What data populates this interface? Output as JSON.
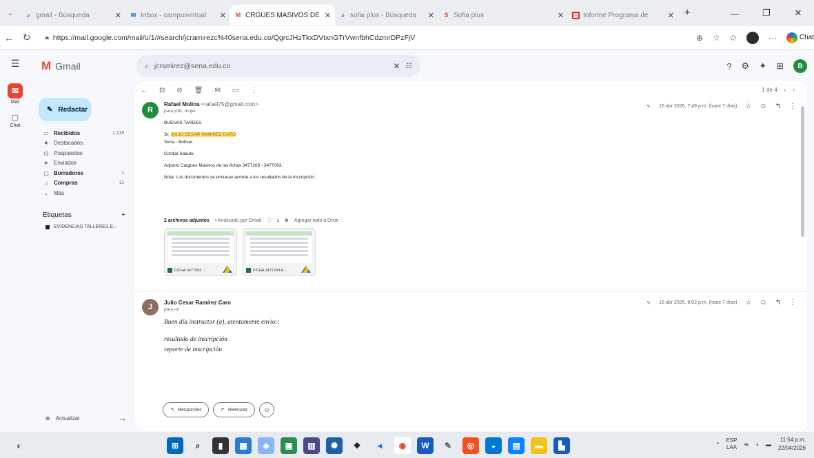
{
  "browser": {
    "tabs": [
      {
        "title": "gmail - Búsqueda",
        "fav": "search",
        "active": false
      },
      {
        "title": "Inbox - campusvirtual",
        "fav": "mail",
        "active": false
      },
      {
        "title": "CRGUES MASIVOS DE",
        "fav": "gmail",
        "active": true
      },
      {
        "title": "sofia plus - Búsqueda",
        "fav": "search",
        "active": false
      },
      {
        "title": "Sofia plus",
        "fav": "sofia",
        "active": false
      },
      {
        "title": "Informe Programa de",
        "fav": "pdf",
        "active": false
      }
    ],
    "url": "https://mail.google.com/mail/u/1/#search/jcramirezc%40sena.edu.co/QgrcJHzTkxDVtxnGTrVwnfbhCdzmrDPzFjV",
    "copilot_label": "Chat"
  },
  "gmail": {
    "app_name": "Gmail",
    "rail_mail_label": "Mail",
    "rail_chat_label": "Chat",
    "search_query": "jcramirez@sena.edu.co",
    "account_initial": "B",
    "compose_label": "Redactar",
    "nav": [
      {
        "icon": "inbox",
        "label": "Recibidos",
        "count": "1.119",
        "bold": true
      },
      {
        "icon": "star",
        "label": "Destacados",
        "count": "",
        "bold": false
      },
      {
        "icon": "clock",
        "label": "Pospuestos",
        "count": "",
        "bold": false
      },
      {
        "icon": "send",
        "label": "Enviados",
        "count": "",
        "bold": false
      },
      {
        "icon": "draft",
        "label": "Borradores",
        "count": "1",
        "bold": true
      },
      {
        "icon": "cart",
        "label": "Compras",
        "count": "11",
        "bold": true
      },
      {
        "icon": "chevron",
        "label": "Más",
        "count": "",
        "bold": false
      }
    ],
    "labels_title": "Etiquetas",
    "labels_add": "+",
    "label_item": "EVIDENCIAS TALLERES E...",
    "upgrade_label": "Actualizar",
    "pager_text": "1 de 4"
  },
  "thread": {
    "msg1": {
      "avatar": "R",
      "avatar_color": "#1e8e3e",
      "sender": "Rafael Molina",
      "email": "<rafael75@gmail.com>",
      "to": "para jcdc, mujer",
      "meta": "15 abr 2026, 7:49 p.m. (hace 7 días)",
      "lines": [
        "BUENAS TARDES",
        "",
        "Sr. JULIO CESAR RAMIREZ CARO",
        "Sena - Bolívar.",
        "",
        "Cordial Saludo.",
        "",
        "Adjunto Cargues Masivos de las fichas 3477203 - 3477093.",
        "",
        "Nota: Los documentos se enviaran acorde a los resultados de la inscripción."
      ],
      "highlight": "JULIO CESAR RAMIREZ CARO",
      "attachments_title": "2 archivos adjuntos",
      "attachments_scan": "• Analizado por Gmail",
      "attachments_drive": "Agregar todo a Drive",
      "attachments": [
        {
          "name": "FICHA 3477093 ..."
        },
        {
          "name": "FICHA 3477203 A..."
        }
      ]
    },
    "msg2": {
      "avatar": "J",
      "avatar_color": "#8d6e63",
      "sender": "Julio Cesar Ramírez Caro",
      "to": "para mí",
      "meta": "15 abr 2026, 8:02 p.m. (hace 7 días)",
      "lines": [
        "Buen día instructor (a), atentamente envío::",
        "",
        "resultado de inscripción",
        "reporte de inscripción"
      ]
    },
    "reply_label": "Responder",
    "forward_label": "Reenviar"
  },
  "taskbar": {
    "lang_top": "ESP",
    "lang_bottom": "LAA",
    "time": "11:54 p.m.",
    "date": "22/04/2026"
  },
  "colors": {
    "gmail_red": "#ea4335",
    "compose_bg": "#c2e7ff",
    "highlight": "#f7e36b"
  }
}
